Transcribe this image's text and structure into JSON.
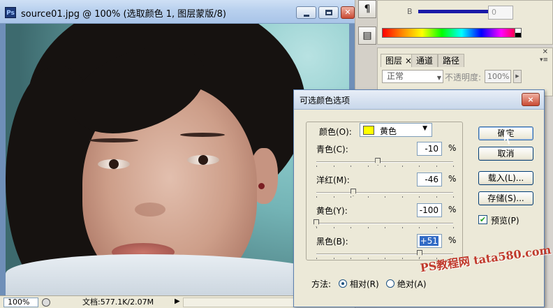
{
  "document": {
    "app_badge": "Ps",
    "title": "source01.jpg @ 100% (选取颜色 1, 图层蒙版/8)",
    "status": {
      "zoom": "100%",
      "doc_info": "文档:577.1K/2.07M"
    }
  },
  "panels": {
    "paragraph_glyph": "¶",
    "color": {
      "channel_label": "B",
      "value": "0"
    },
    "layers": {
      "tabs": [
        {
          "label": "图层"
        },
        {
          "label": "通道"
        },
        {
          "label": "路径"
        }
      ],
      "tab_close": "×",
      "blend_mode": "正常",
      "opacity_label": "不透明度:",
      "opacity_value": "100%"
    }
  },
  "dialog": {
    "title": "可选颜色选项",
    "close_glyph": "×",
    "colors_label": "颜色(O):",
    "colors_value": "黄色",
    "colors_swatch": "#ffff00",
    "sliders": [
      {
        "label": "青色(C):",
        "value": "-10",
        "level": -10
      },
      {
        "label": "洋红(M):",
        "value": "-46",
        "level": -46
      },
      {
        "label": "黄色(Y):",
        "value": "-100",
        "level": -100
      },
      {
        "label": "黑色(B):",
        "value": "+51",
        "level": 51,
        "selected": true
      }
    ],
    "percent": "%",
    "method_label": "方法:",
    "method_options": [
      {
        "label": "相对(R)",
        "selected": true
      },
      {
        "label": "绝对(A)",
        "selected": false
      }
    ],
    "buttons": {
      "ok": "确定",
      "cancel": "取消",
      "load": "载入(L)...",
      "save": "存储(S)..."
    },
    "preview_label": "预览(P)",
    "preview_checked": true
  },
  "watermark": "PS教程网 tata580.com"
}
